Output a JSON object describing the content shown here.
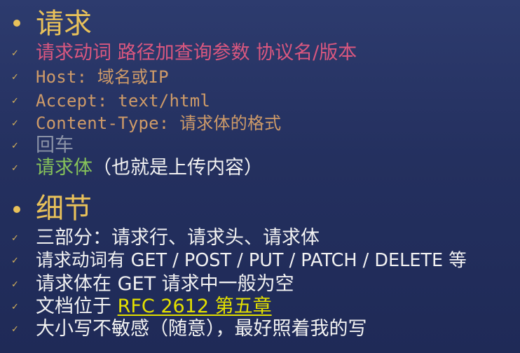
{
  "sections": [
    {
      "title": "请求",
      "items": [
        {
          "text": "请求动词 路径加查询参数 协议名/版本"
        },
        {
          "text": "Host: 域名或IP"
        },
        {
          "text": "Accept: text/html"
        },
        {
          "text": "Content-Type: 请求体的格式"
        },
        {
          "text": "回车"
        },
        {
          "text_a": "请求体",
          "text_b": "（也就是上传内容）"
        }
      ]
    },
    {
      "title": "细节",
      "items": [
        {
          "text": "三部分：请求行、请求头、请求体"
        },
        {
          "text": "请求动词有 GET / POST / PUT / PATCH / DELETE 等"
        },
        {
          "text": "请求体在 GET 请求中一般为空"
        },
        {
          "text_a": "文档位于 ",
          "link": "RFC 2612 第五章"
        },
        {
          "text": "大小写不敏感（随意），最好照着我的写"
        }
      ]
    }
  ],
  "checkmark_glyph": "✓",
  "colors": {
    "heading": "#e8c15a",
    "request_line": "#d9577f",
    "headers": "#cf9b68",
    "newline": "#8b93a7",
    "body": "#86c25a",
    "detail_text": "#f2f2f2",
    "link": "#e3e000"
  }
}
